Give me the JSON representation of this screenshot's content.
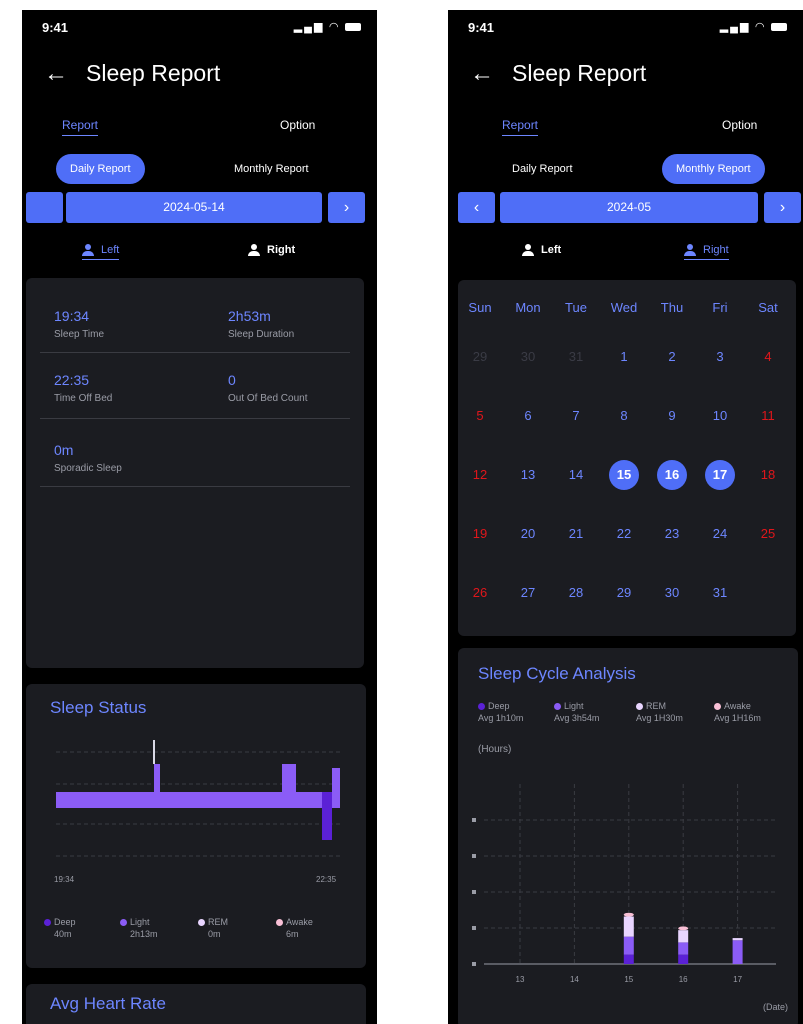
{
  "status_bar": {
    "time": "9:41"
  },
  "header": {
    "title": "Sleep Report"
  },
  "top_tabs": {
    "report": "Report",
    "option": "Option"
  },
  "report_tabs": {
    "daily": "Daily Report",
    "monthly": "Monthly Report"
  },
  "side_tabs": {
    "left": "Left",
    "right": "Right"
  },
  "daily": {
    "date": "2024-05-14",
    "stats": [
      {
        "value": "19:34",
        "label": "Sleep Time"
      },
      {
        "value": "2h53m",
        "label": "Sleep Duration"
      },
      {
        "value": "22:35",
        "label": "Time Off Bed"
      },
      {
        "value": "0",
        "label": "Out Of Bed Count"
      },
      {
        "value": "0m",
        "label": "Sporadic Sleep"
      }
    ],
    "sleep_status": {
      "title": "Sleep Status",
      "start_time": "19:34",
      "end_time": "22:35",
      "legend": [
        {
          "name": "Deep",
          "value": "40m",
          "color": "#5b21d6"
        },
        {
          "name": "Light",
          "value": "2h13m",
          "color": "#8b5cf6"
        },
        {
          "name": "REM",
          "value": "0m",
          "color": "#e9d5ff"
        },
        {
          "name": "Awake",
          "value": "6m",
          "color": "#f9c0d6"
        }
      ]
    },
    "avg_heart_rate_title": "Avg Heart Rate"
  },
  "monthly": {
    "month": "2024-05",
    "weekdays": [
      "Sun",
      "Mon",
      "Tue",
      "Wed",
      "Thu",
      "Fri",
      "Sat"
    ],
    "calendar_rows": [
      [
        "29",
        "30",
        "31",
        "1",
        "2",
        "3",
        "4"
      ],
      [
        "5",
        "6",
        "7",
        "8",
        "9",
        "10",
        "11"
      ],
      [
        "12",
        "13",
        "14",
        "15",
        "16",
        "17",
        "18"
      ],
      [
        "19",
        "20",
        "21",
        "22",
        "23",
        "24",
        "25"
      ],
      [
        "26",
        "27",
        "28",
        "29",
        "30",
        "31",
        ""
      ]
    ],
    "selected_days": [
      "15",
      "16",
      "17"
    ],
    "colors": {
      "weekend": "#e0161b",
      "weekday": "#6d86ff",
      "outside_month": "#3a3b45",
      "selected": "#4f6ef7"
    },
    "cycle_title": "Sleep Cycle Analysis",
    "cycle_legend": [
      {
        "name": "Deep",
        "avg": "Avg 1h10m",
        "color": "#5b21d6"
      },
      {
        "name": "Light",
        "avg": "Avg 3h54m",
        "color": "#8b5cf6"
      },
      {
        "name": "REM",
        "avg": "Avg 1H30m",
        "color": "#e9d5ff"
      },
      {
        "name": "Awake",
        "avg": "Avg 1H16m",
        "color": "#f9c0d6"
      }
    ],
    "y_unit": "(Hours)",
    "x_unit": "(Date)"
  },
  "chart_data": {
    "type": "bar",
    "categories": [
      "13",
      "14",
      "15",
      "16",
      "17"
    ],
    "series": [
      {
        "name": "Deep",
        "values": [
          0,
          0,
          1.3,
          1.3,
          0
        ]
      },
      {
        "name": "Light",
        "values": [
          0,
          0,
          2.5,
          1.7,
          3.3
        ]
      },
      {
        "name": "REM",
        "values": [
          0,
          0,
          2.8,
          1.7,
          0.3
        ]
      },
      {
        "name": "Awake",
        "values": [
          0,
          0,
          0.5,
          0.5,
          0
        ]
      }
    ],
    "x": [
      "13",
      "14",
      "15",
      "16",
      "17"
    ],
    "xlabel": "(Date)",
    "ylabel": "(Hours)",
    "ylim": [
      0,
      25
    ]
  }
}
